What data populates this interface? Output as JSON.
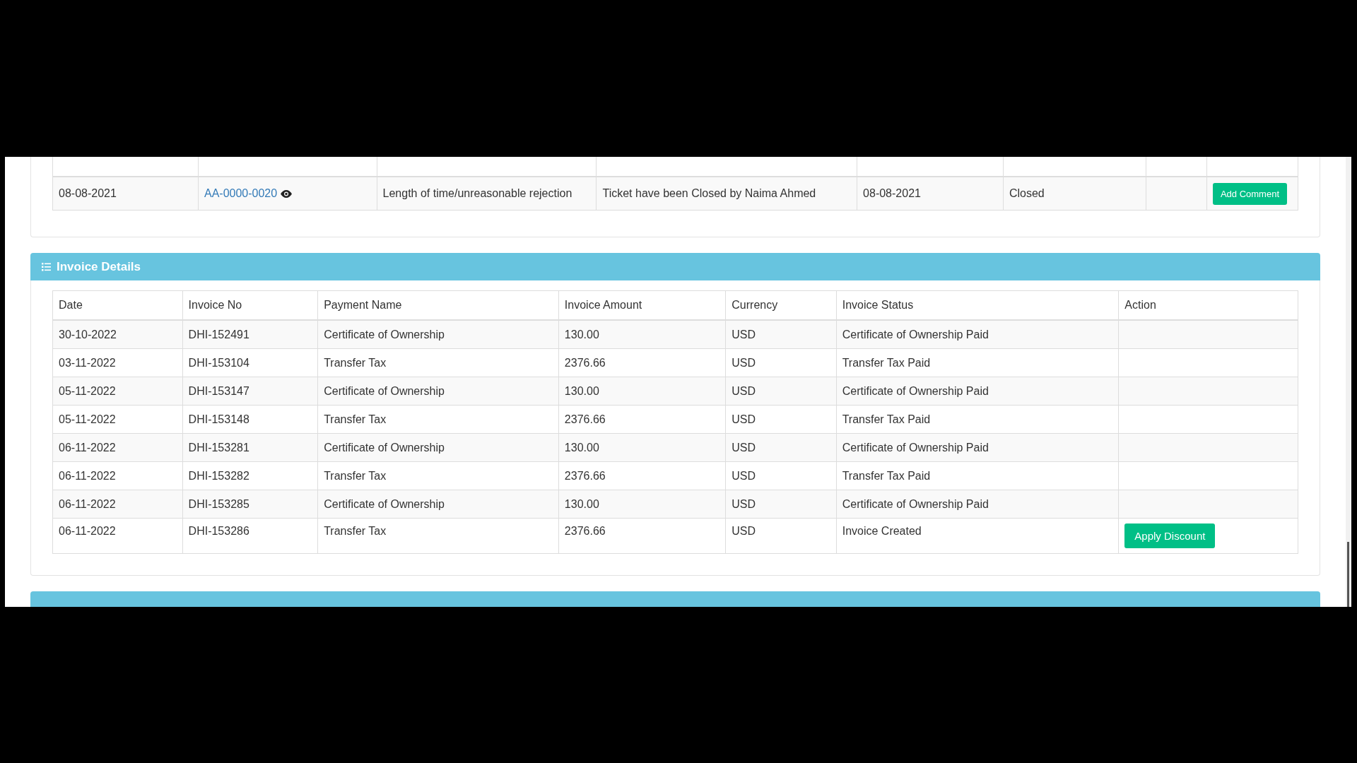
{
  "ticket_table": {
    "rows": [
      {
        "date": "08-08-2021",
        "ticket_no": "AA-0000-0020",
        "subject": "Length of time/unreasonable rejection",
        "description": "Ticket have been Closed by Naima Ahmed",
        "due_date": "08-08-2021",
        "status": "Closed",
        "action": "Add Comment"
      }
    ]
  },
  "invoice_section": {
    "title": "Invoice Details",
    "columns": [
      "Date",
      "Invoice No",
      "Payment Name",
      "Invoice Amount",
      "Currency",
      "Invoice Status",
      "Action"
    ],
    "rows": [
      {
        "date": "30-10-2022",
        "invoice_no": "DHI-152491",
        "payment_name": "Certificate of Ownership",
        "amount": "130.00",
        "currency": "USD",
        "status": "Certificate of Ownership Paid"
      },
      {
        "date": "03-11-2022",
        "invoice_no": "DHI-153104",
        "payment_name": "Transfer Tax",
        "amount": "2376.66",
        "currency": "USD",
        "status": "Transfer Tax Paid"
      },
      {
        "date": "05-11-2022",
        "invoice_no": "DHI-153147",
        "payment_name": "Certificate of Ownership",
        "amount": "130.00",
        "currency": "USD",
        "status": "Certificate of Ownership Paid"
      },
      {
        "date": "05-11-2022",
        "invoice_no": "DHI-153148",
        "payment_name": "Transfer Tax",
        "amount": "2376.66",
        "currency": "USD",
        "status": "Transfer Tax Paid"
      },
      {
        "date": "06-11-2022",
        "invoice_no": "DHI-153281",
        "payment_name": "Certificate of Ownership",
        "amount": "130.00",
        "currency": "USD",
        "status": "Certificate of Ownership Paid"
      },
      {
        "date": "06-11-2022",
        "invoice_no": "DHI-153282",
        "payment_name": "Transfer Tax",
        "amount": "2376.66",
        "currency": "USD",
        "status": "Transfer Tax Paid"
      },
      {
        "date": "06-11-2022",
        "invoice_no": "DHI-153285",
        "payment_name": "Certificate of Ownership",
        "amount": "130.00",
        "currency": "USD",
        "status": "Certificate of Ownership Paid"
      },
      {
        "date": "06-11-2022",
        "invoice_no": "DHI-153286",
        "payment_name": "Transfer Tax",
        "amount": "2376.66",
        "currency": "USD",
        "status": "Invoice Created",
        "action": "Apply Discount"
      }
    ]
  },
  "next_section": {
    "kind": "panel-heading"
  }
}
